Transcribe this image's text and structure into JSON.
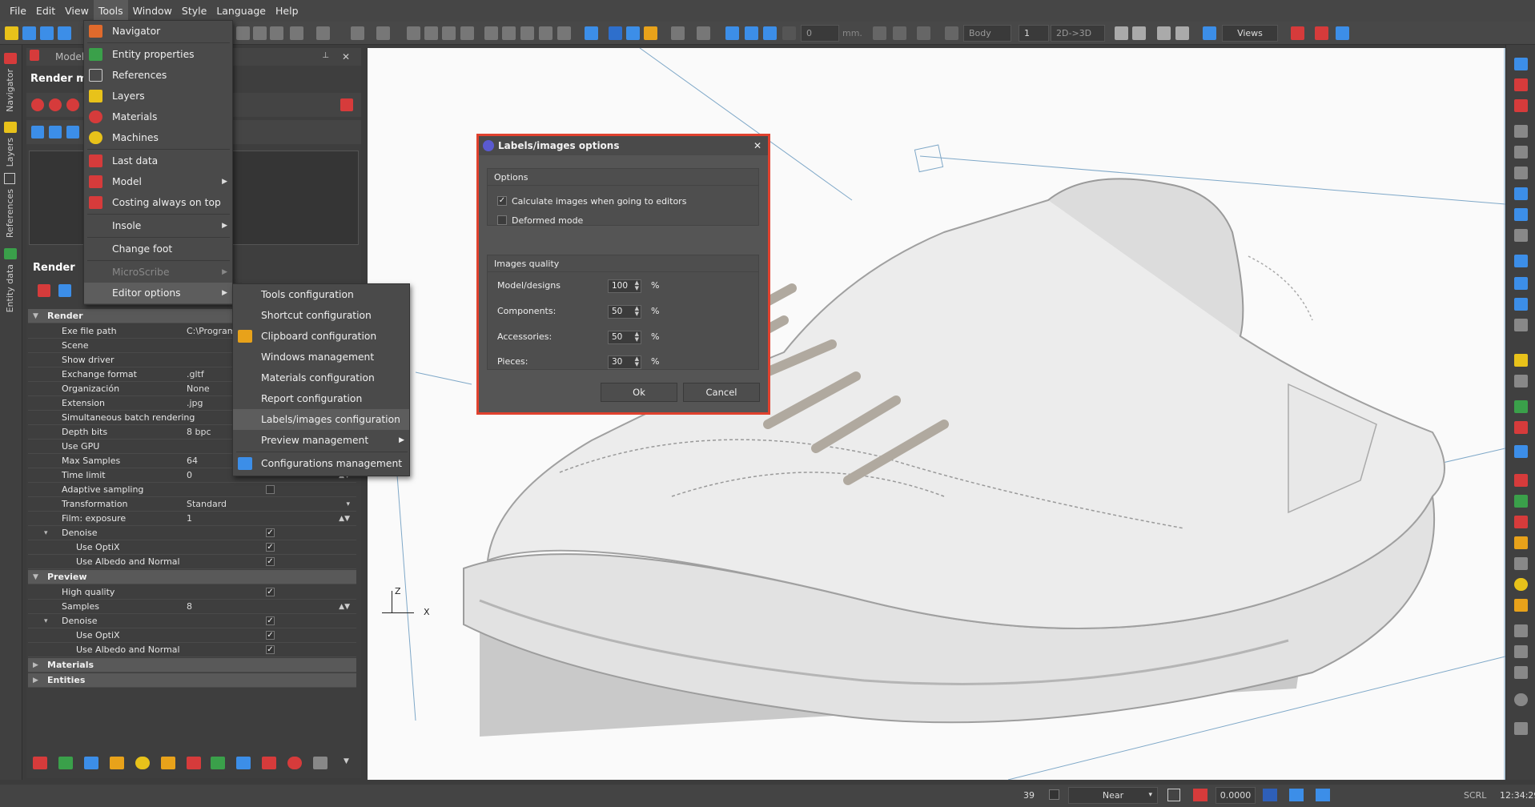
{
  "menubar": {
    "items": [
      "File",
      "Edit",
      "View",
      "Tools",
      "Window",
      "Style",
      "Language",
      "Help"
    ]
  },
  "toolbar": {
    "num_value": "0",
    "unit": "mm.",
    "body_select": "Body",
    "count": "1",
    "mode": "2D->3D",
    "views": "Views"
  },
  "left_strip": {
    "tabs": [
      "Navigator",
      "Layers",
      "References",
      "Entity data"
    ]
  },
  "model_panel": {
    "title": "Model",
    "subtitle": "Render ma"
  },
  "render_panel": {
    "title": "Render",
    "rows": [
      {
        "type": "section",
        "name": "Render"
      },
      {
        "name": "Exe file path",
        "value": "C:\\Program"
      },
      {
        "name": "Scene",
        "value": ""
      },
      {
        "name": "Show driver",
        "value": ""
      },
      {
        "name": "Exchange format",
        "value": ".gltf"
      },
      {
        "name": "Organización",
        "value": "None"
      },
      {
        "name": "Extension",
        "value": ".jpg"
      },
      {
        "name": "Simultaneous batch rendering",
        "value": ""
      },
      {
        "name": "Depth bits",
        "value": "8 bpc"
      },
      {
        "name": "Use GPU",
        "value": ""
      },
      {
        "name": "Max Samples",
        "value": "64"
      },
      {
        "name": "Time limit",
        "value": "0"
      },
      {
        "name": "Adaptive sampling",
        "value": ""
      },
      {
        "name": "Transformation",
        "value": "Standard"
      },
      {
        "name": "Film: exposure",
        "value": "1"
      },
      {
        "name": "Denoise",
        "value": ""
      },
      {
        "name": "Use OptiX",
        "value": ""
      },
      {
        "name": "Use Albedo and Normal",
        "value": ""
      },
      {
        "type": "section",
        "name": "Preview"
      },
      {
        "name": "High quality",
        "value": ""
      },
      {
        "name": "Samples",
        "value": "8"
      },
      {
        "name": "Denoise",
        "value": ""
      },
      {
        "name": "Use OptiX",
        "value": ""
      },
      {
        "name": "Use Albedo and Normal",
        "value": ""
      },
      {
        "type": "section",
        "name": "Materials"
      },
      {
        "type": "section",
        "name": "Entities"
      }
    ]
  },
  "tools_menu": {
    "items": [
      {
        "label": "Navigator",
        "icon": "navigator-icon",
        "color": "#e06a2c"
      },
      {
        "label": "Entity properties",
        "icon": "entity-properties-icon",
        "color": "#3aa04a"
      },
      {
        "label": "References",
        "icon": "references-icon",
        "color": "#cccccc"
      },
      {
        "label": "Layers",
        "icon": "layers-icon",
        "color": "#e8c21a"
      },
      {
        "label": "Materials",
        "icon": "materials-icon",
        "color": "#d63b3b"
      },
      {
        "label": "Machines",
        "icon": "machines-icon",
        "color": "#e8c21a"
      },
      {
        "label": "Last data",
        "icon": "last-data-icon",
        "color": "#d63b3b"
      },
      {
        "label": "Model",
        "icon": "model-icon",
        "color": "#d63b3b"
      },
      {
        "label": "Costing always on top",
        "icon": "costing-icon",
        "color": "#d63b3b"
      },
      {
        "label": "Insole",
        "icon": "",
        "color": ""
      },
      {
        "label": "Change foot",
        "icon": "",
        "color": ""
      },
      {
        "label": "MicroScribe",
        "icon": "",
        "color": ""
      },
      {
        "label": "Editor options",
        "icon": "",
        "color": ""
      }
    ]
  },
  "editor_submenu": {
    "items": [
      {
        "label": "Tools configuration"
      },
      {
        "label": "Shortcut configuration"
      },
      {
        "label": "Clipboard configuration"
      },
      {
        "label": "Windows management"
      },
      {
        "label": "Materials configuration"
      },
      {
        "label": "Report configuration"
      },
      {
        "label": "Labels/images configuration"
      },
      {
        "label": "Preview management"
      },
      {
        "label": "Configurations management"
      }
    ]
  },
  "dialog": {
    "title": "Labels/images options",
    "options_group": "Options",
    "calc_label": "Calculate images when going to editors",
    "calc_checked": true,
    "deformed_label": "Deformed mode",
    "deformed_checked": false,
    "quality_group": "Images quality",
    "model_label": "Model/designs",
    "model_value": "100",
    "components_label": "Components:",
    "components_value": "50",
    "accessories_label": "Accessories:",
    "accessories_value": "50",
    "pieces_label": "Pieces:",
    "pieces_value": "30",
    "percent": "%",
    "ok": "Ok",
    "cancel": "Cancel"
  },
  "viewport": {
    "axis_z": "Z",
    "axis_x": "X"
  },
  "statusbar": {
    "number": "39",
    "snap": "Near",
    "value": "0.0000",
    "scrl": "SCRL",
    "time": "12:34:29"
  },
  "colors": {
    "highlight": "#e0412e",
    "accent_blue": "#3c8ee8"
  }
}
